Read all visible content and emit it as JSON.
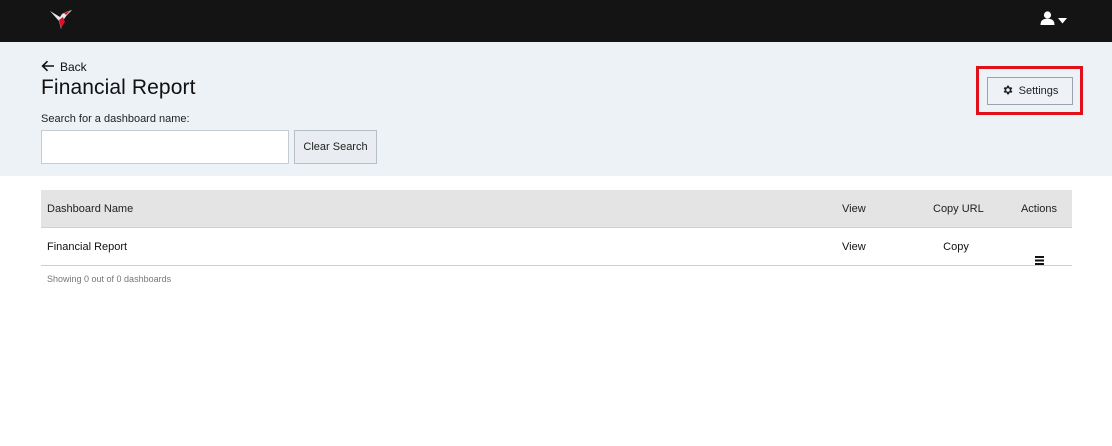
{
  "topbar": {
    "logo_icon": "hummingbird-logo-icon",
    "user_icon": "user-icon",
    "caret_icon": "caret-down-icon"
  },
  "header": {
    "back_label": "Back",
    "title": "Financial Report",
    "search_label": "Search for a dashboard name:",
    "search_value": "",
    "search_placeholder": "",
    "clear_label": "Clear Search",
    "settings_label": "Settings",
    "highlight_color": "#e0101a"
  },
  "table": {
    "columns": {
      "name": "Dashboard Name",
      "view": "View",
      "copy": "Copy URL",
      "actions": "Actions"
    },
    "rows": [
      {
        "name": "Financial Report",
        "view": "View",
        "copy": "Copy",
        "actions_icon": "menu-icon"
      }
    ]
  },
  "footer": {
    "count_text": "Showing 0 out of 0 dashboards"
  }
}
